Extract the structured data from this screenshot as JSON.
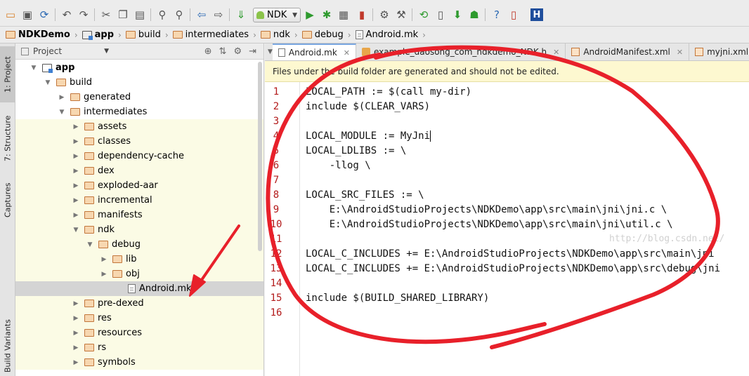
{
  "toolbar": {
    "run_config_label": "NDK",
    "icons": [
      "open-icon",
      "save-icon",
      "sync-icon",
      "undo-icon",
      "redo-icon",
      "cut-icon",
      "copy-icon",
      "paste-icon",
      "find-icon",
      "replace-icon",
      "back-icon",
      "forward-icon",
      "make-icon",
      "run-icon",
      "debug-icon",
      "coverage-icon",
      "stop-icon",
      "settings-icon",
      "sdk-manager-icon",
      "avd-icon",
      "gradle-sync-icon",
      "android-monitor-icon",
      "help-icon",
      "device-icon",
      "h-icon"
    ],
    "h_label": "H"
  },
  "breadcrumb": [
    "NDKDemo",
    "app",
    "build",
    "intermediates",
    "ndk",
    "debug",
    "Android.mk"
  ],
  "left_strip": {
    "project_tab": "1: Project",
    "structure_tab": "7: Structure",
    "captures_tab": "Captures",
    "build_variants_tab": "Build Variants"
  },
  "project_panel": {
    "view_selector": "Project",
    "tree": [
      {
        "label": "app",
        "bold": true,
        "indent": 0,
        "state": "open",
        "icon": "module"
      },
      {
        "label": "build",
        "indent": 1,
        "state": "open",
        "icon": "folder"
      },
      {
        "label": "generated",
        "indent": 2,
        "state": "closed",
        "icon": "folder"
      },
      {
        "label": "intermediates",
        "indent": 2,
        "state": "open",
        "icon": "folder"
      },
      {
        "label": "assets",
        "indent": 3,
        "state": "closed",
        "icon": "folder"
      },
      {
        "label": "classes",
        "indent": 3,
        "state": "closed",
        "icon": "folder"
      },
      {
        "label": "dependency-cache",
        "indent": 3,
        "state": "closed",
        "icon": "folder"
      },
      {
        "label": "dex",
        "indent": 3,
        "state": "closed",
        "icon": "folder"
      },
      {
        "label": "exploded-aar",
        "indent": 3,
        "state": "closed",
        "icon": "folder"
      },
      {
        "label": "incremental",
        "indent": 3,
        "state": "closed",
        "icon": "folder"
      },
      {
        "label": "manifests",
        "indent": 3,
        "state": "closed",
        "icon": "folder"
      },
      {
        "label": "ndk",
        "indent": 3,
        "state": "open",
        "icon": "folder"
      },
      {
        "label": "debug",
        "indent": 4,
        "state": "open",
        "icon": "folder"
      },
      {
        "label": "lib",
        "indent": 5,
        "state": "closed",
        "icon": "folder"
      },
      {
        "label": "obj",
        "indent": 5,
        "state": "closed",
        "icon": "folder"
      },
      {
        "label": "Android.mk",
        "indent": 6,
        "state": "leaf",
        "icon": "file",
        "selected": true
      },
      {
        "label": "pre-dexed",
        "indent": 3,
        "state": "closed",
        "icon": "folder"
      },
      {
        "label": "res",
        "indent": 3,
        "state": "closed",
        "icon": "folder"
      },
      {
        "label": "resources",
        "indent": 3,
        "state": "closed",
        "icon": "folder"
      },
      {
        "label": "rs",
        "indent": 3,
        "state": "closed",
        "icon": "folder"
      },
      {
        "label": "symbols",
        "indent": 3,
        "state": "closed",
        "icon": "folder"
      }
    ]
  },
  "editor": {
    "tabs": [
      {
        "label": "Android.mk",
        "active": true,
        "icon": "mk"
      },
      {
        "label": "example_daosong_com_ndkdemo_NDK.h",
        "active": false,
        "icon": "h"
      },
      {
        "label": "AndroidManifest.xml",
        "active": false,
        "icon": "xml"
      },
      {
        "label": "myjni.xml",
        "active": false,
        "icon": "xml"
      }
    ],
    "banner": "Files under the build folder are generated and should not be edited.",
    "watermark": "http://blog.csdn.net/",
    "lines": [
      "LOCAL_PATH := $(call my-dir)",
      "include $(CLEAR_VARS)",
      "",
      "LOCAL_MODULE := MyJni",
      "LOCAL_LDLIBS := \\",
      "    -llog \\",
      "",
      "LOCAL_SRC_FILES := \\",
      "    E:\\AndroidStudioProjects\\NDKDemo\\app\\src\\main\\jni\\jni.c \\",
      "    E:\\AndroidStudioProjects\\NDKDemo\\app\\src\\main\\jni\\util.c \\",
      "",
      "LOCAL_C_INCLUDES += E:\\AndroidStudioProjects\\NDKDemo\\app\\src\\main\\jni",
      "LOCAL_C_INCLUDES += E:\\AndroidStudioProjects\\NDKDemo\\app\\src\\debug\\jni",
      "",
      "include $(BUILD_SHARED_LIBRARY)",
      ""
    ]
  },
  "colors": {
    "annotation_red": "#e8202a",
    "line_number": "#b31b1b",
    "banner_bg": "#fdf8d0",
    "tree_highlight": "#fbfbe5",
    "tree_selected": "#d4d4d4"
  }
}
